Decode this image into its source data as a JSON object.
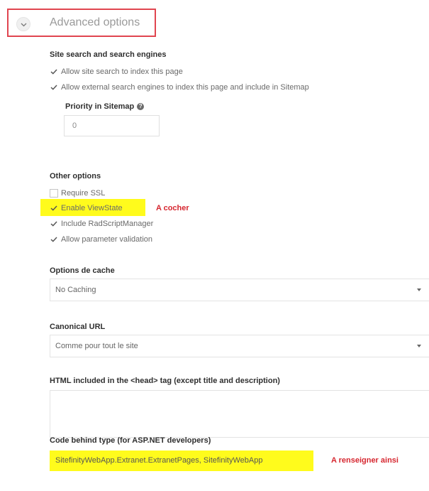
{
  "advanced": {
    "title": "Advanced options",
    "toggle_icon": "chevron-down-icon"
  },
  "search_section": {
    "heading": "Site search and search engines",
    "options": [
      {
        "label": "Allow site search to index this page",
        "checked": true
      },
      {
        "label": "Allow external search engines to index this page and include in Sitemap",
        "checked": true
      }
    ],
    "priority_label": "Priority in Sitemap",
    "priority_help_icon": "question-circle-icon",
    "priority_value": "0"
  },
  "other_section": {
    "heading": "Other options",
    "options": [
      {
        "label": "Require SSL",
        "checked": false
      },
      {
        "label": "Enable ViewState",
        "checked": true
      },
      {
        "label": "Include RadScriptManager",
        "checked": true
      },
      {
        "label": "Allow parameter validation",
        "checked": true
      }
    ],
    "annotation": "A cocher"
  },
  "cache": {
    "label": "Options de cache",
    "selected": "No Caching"
  },
  "canonical": {
    "label": "Canonical URL",
    "selected": "Comme pour tout le site"
  },
  "head_html": {
    "label": "HTML included in the <head> tag (except title and description)",
    "value": ""
  },
  "code_behind": {
    "label": "Code behind type (for ASP.NET developers)",
    "value": "SitefinityWebApp.Extranet.ExtranetPages, SitefinityWebApp",
    "annotation": "A renseigner ainsi"
  },
  "colors": {
    "highlight": "#fffb1c",
    "annotation": "#d6262f",
    "frame": "#e0454f"
  }
}
